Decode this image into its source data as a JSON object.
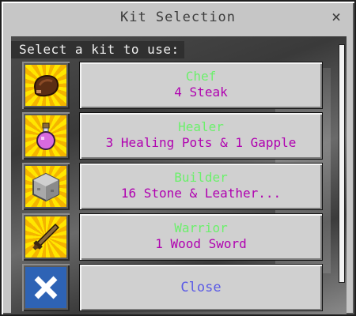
{
  "window": {
    "title": "Kit Selection",
    "close_symbol": "×"
  },
  "prompt": "Select a kit to use:",
  "colors": {
    "kit_name": "#6cf06c",
    "kit_desc": "#b000b0",
    "close_label": "#5a5ae6"
  },
  "kits": [
    {
      "name": "Chef",
      "desc": "4 Steak",
      "icon": "steak-icon"
    },
    {
      "name": "Healer",
      "desc": "3 Healing Pots & 1 Gapple",
      "icon": "potion-icon"
    },
    {
      "name": "Builder",
      "desc": "16 Stone & Leather...",
      "icon": "stone-block-icon"
    },
    {
      "name": "Warrior",
      "desc": "1 Wood Sword",
      "icon": "wood-sword-icon"
    }
  ],
  "close_button": {
    "label": "Close",
    "icon": "close-icon"
  }
}
